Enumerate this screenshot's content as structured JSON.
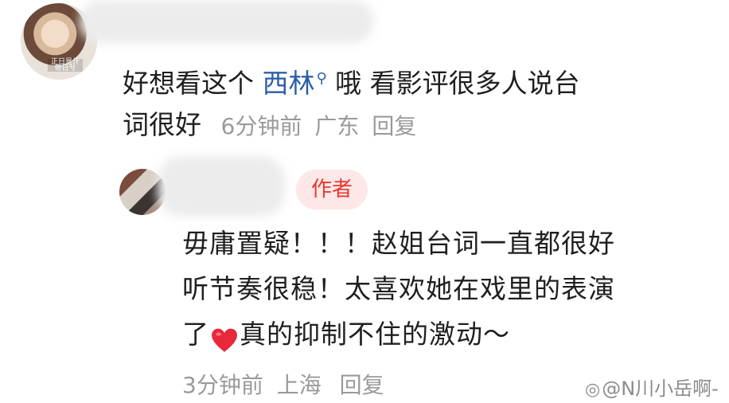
{
  "comment1": {
    "text_before_link": "好想看这个 ",
    "link_text": "西林",
    "text_after_link": " 哦 看影评很多人说台",
    "line2_text": "词很好",
    "time": "6分钟前",
    "location": "广东",
    "reply_label": "回复",
    "avatar_caption": "正日是什 帝日兮"
  },
  "comment2": {
    "author_badge": "作者",
    "line1": "毋庸置疑！！！赵姐台词一直都很好",
    "line2": "听节奏很稳！太喜欢她在戏里的表演",
    "line3_prefix": "了",
    "line3_suffix": "真的抑制不住的激动～",
    "time": "3分钟前",
    "location": "上海",
    "reply_label": "回复"
  },
  "watermark": {
    "text": "@N川小岳啊-"
  },
  "colors": {
    "link": "#2b5ea8",
    "badge_bg": "#fde7e7",
    "badge_text": "#e8382f",
    "meta": "#9a9a9a",
    "heart": "#e8283b"
  }
}
